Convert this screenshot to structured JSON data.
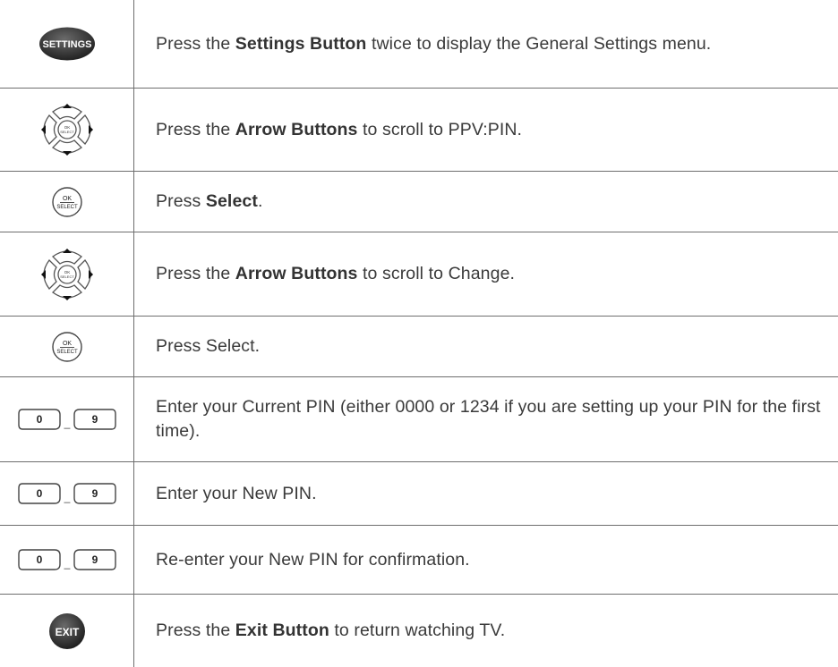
{
  "rows": [
    {
      "icon": "settings-button-icon",
      "icon_label": "SETTINGS",
      "pre": "Press the ",
      "bold": "Settings Button",
      "post": " twice to display the General Settings menu."
    },
    {
      "icon": "arrow-pad-icon",
      "icon_label": "OK SELECT",
      "pre": "Press the ",
      "bold": "Arrow Buttons",
      "post": " to scroll to PPV:PIN."
    },
    {
      "icon": "ok-select-button-icon",
      "icon_label": "OK SELECT",
      "pre": "Press ",
      "bold": "Select",
      "post": "."
    },
    {
      "icon": "arrow-pad-icon",
      "icon_label": "OK SELECT",
      "pre": "Press the ",
      "bold": "Arrow Buttons",
      "post": " to scroll to Change."
    },
    {
      "icon": "ok-select-button-icon",
      "icon_label": "OK SELECT",
      "pre": "Press Select.",
      "bold": "",
      "post": ""
    },
    {
      "icon": "number-keys-icon",
      "key_first": "0",
      "key_last": "9",
      "key_sep": "_",
      "pre": "Enter your Current PIN (either 0000 or 1234 if you are setting up your PIN for the first time).",
      "bold": "",
      "post": ""
    },
    {
      "icon": "number-keys-icon",
      "key_first": "0",
      "key_last": "9",
      "key_sep": "_",
      "pre": "Enter your New PIN.",
      "bold": "",
      "post": ""
    },
    {
      "icon": "number-keys-icon",
      "key_first": "0",
      "key_last": "9",
      "key_sep": "_",
      "pre": "Re-enter your New PIN for confirmation.",
      "bold": "",
      "post": ""
    },
    {
      "icon": "exit-button-icon",
      "icon_label": "EXIT",
      "pre": "Press the ",
      "bold": "Exit Button",
      "post": " to return watching TV."
    }
  ]
}
